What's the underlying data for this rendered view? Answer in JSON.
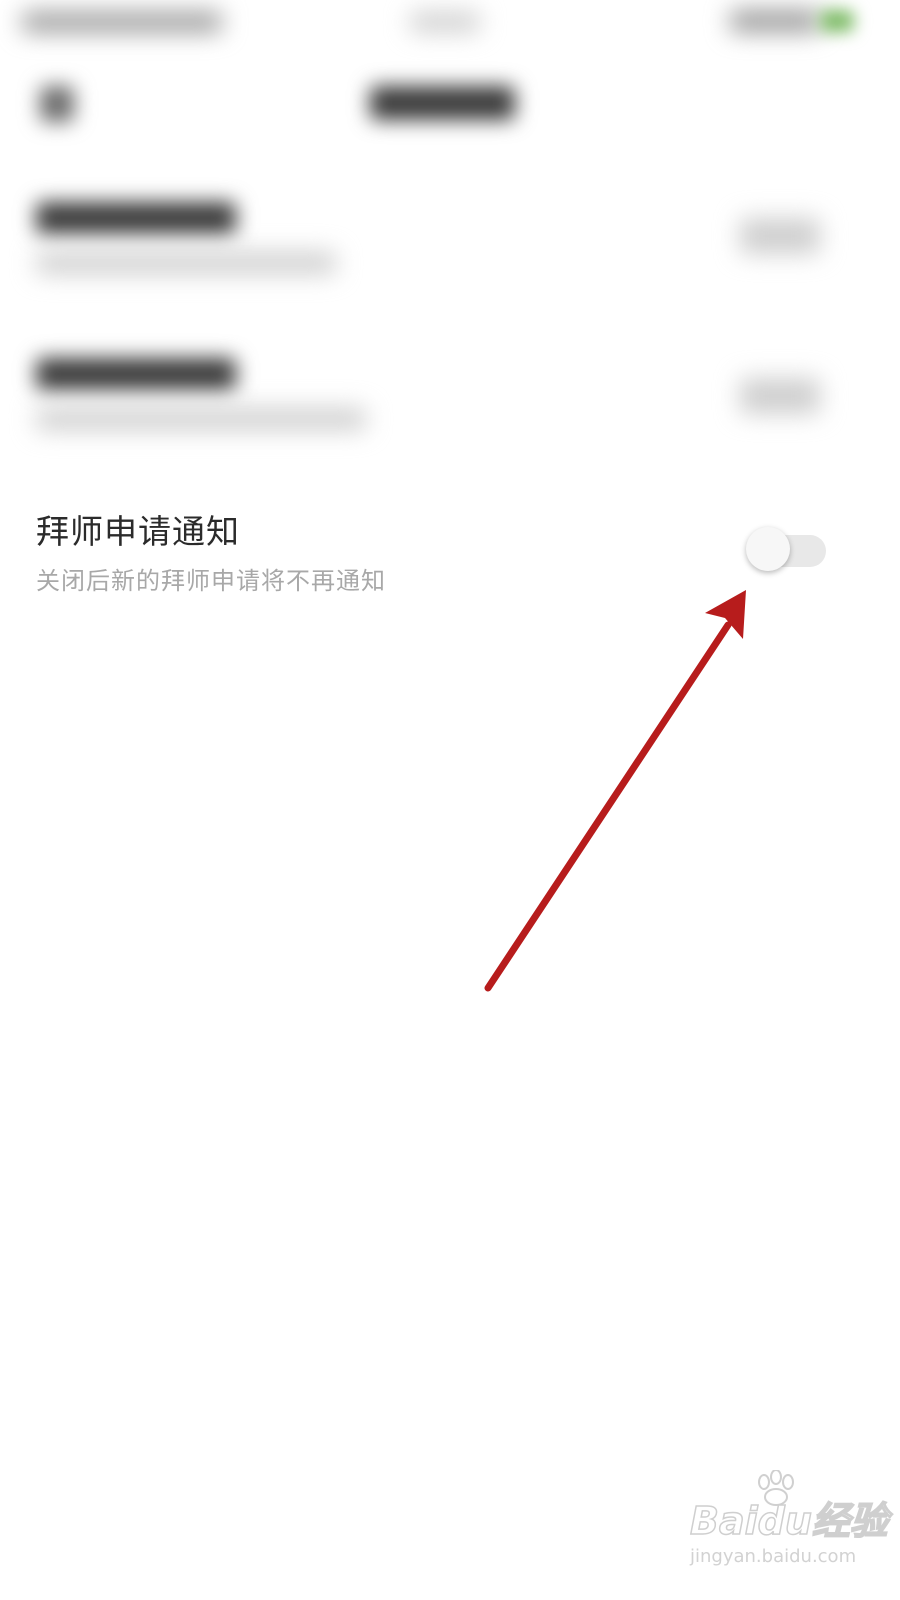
{
  "setting": {
    "title": "拜师申请通知",
    "subtitle": "关闭后新的拜师申请将不再通知",
    "enabled": false
  },
  "watermark": {
    "logo_text": "Baidu经验",
    "url": "jingyan.baidu.com"
  },
  "colors": {
    "annotation_arrow": "#b71c1c",
    "title_text": "#2b2b2b",
    "subtitle_text": "#a8a8a8",
    "toggle_track_off": "#e8e8e8"
  },
  "icons": {
    "annotation": "red-arrow-icon",
    "watermark": "baidu-paw-icon"
  }
}
